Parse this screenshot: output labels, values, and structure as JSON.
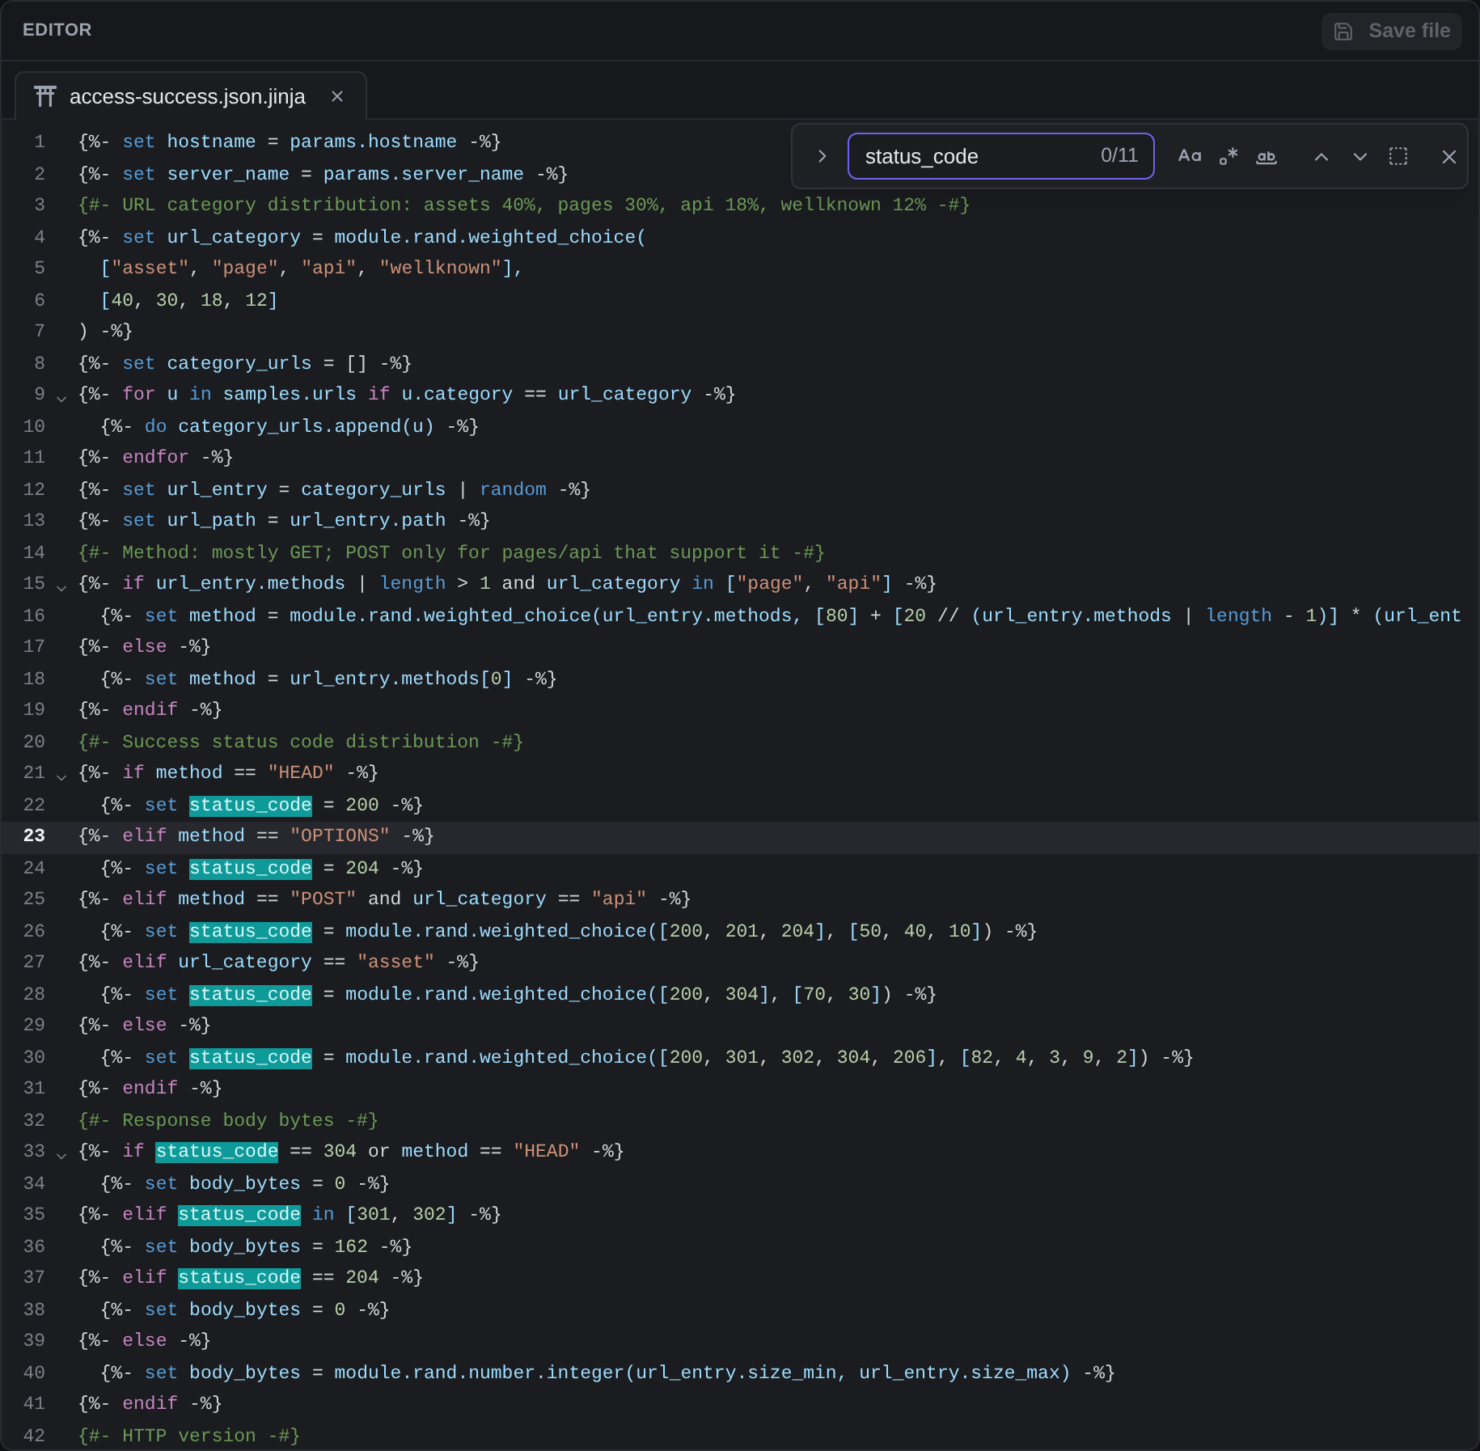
{
  "header": {
    "title": "EDITOR",
    "save_button": {
      "label": "Save file",
      "disabled": true
    }
  },
  "tabs": [
    {
      "label": "access-success.json.jinja",
      "selected": true
    }
  ],
  "find": {
    "value": "status_code",
    "count": "0/11"
  },
  "lines": [
    {
      "number": "1",
      "fold": false,
      "current": false,
      "tokens": [
        {
          "kind": "punct",
          "text": "{%- "
        },
        {
          "kind": "keyword",
          "text": "set"
        },
        {
          "kind": "name",
          "text": " hostname "
        },
        {
          "kind": "punct",
          "text": "= "
        },
        {
          "kind": "name",
          "text": "params.hostname "
        },
        {
          "kind": "punct",
          "text": "-%}"
        }
      ]
    },
    {
      "number": "2",
      "fold": false,
      "current": false,
      "tokens": [
        {
          "kind": "punct",
          "text": "{%- "
        },
        {
          "kind": "keyword",
          "text": "set"
        },
        {
          "kind": "name",
          "text": " server_name "
        },
        {
          "kind": "punct",
          "text": "= "
        },
        {
          "kind": "name",
          "text": "params.server_name "
        },
        {
          "kind": "punct",
          "text": "-%}"
        }
      ]
    },
    {
      "number": "3",
      "fold": false,
      "current": false,
      "tokens": [
        {
          "kind": "comment",
          "text": "{#- URL category distribution: assets 40%, pages 30%, api 18%, wellknown 12% -#}"
        }
      ]
    },
    {
      "number": "4",
      "fold": false,
      "current": false,
      "tokens": [
        {
          "kind": "punct",
          "text": "{%- "
        },
        {
          "kind": "keyword",
          "text": "set"
        },
        {
          "kind": "name",
          "text": " url_category "
        },
        {
          "kind": "punct",
          "text": "= "
        },
        {
          "kind": "name",
          "text": "module.rand.weighted_choice("
        }
      ]
    },
    {
      "number": "5",
      "fold": false,
      "current": false,
      "tokens": [
        {
          "kind": "name",
          "text": "  ["
        },
        {
          "kind": "string",
          "text": "\"asset\""
        },
        {
          "kind": "punct",
          "text": ", "
        },
        {
          "kind": "string",
          "text": "\"page\""
        },
        {
          "kind": "punct",
          "text": ", "
        },
        {
          "kind": "string",
          "text": "\"api\""
        },
        {
          "kind": "punct",
          "text": ", "
        },
        {
          "kind": "string",
          "text": "\"wellknown\""
        },
        {
          "kind": "name",
          "text": "],"
        }
      ]
    },
    {
      "number": "6",
      "fold": false,
      "current": false,
      "tokens": [
        {
          "kind": "name",
          "text": "  ["
        },
        {
          "kind": "number",
          "text": "40"
        },
        {
          "kind": "punct",
          "text": ", "
        },
        {
          "kind": "number",
          "text": "30"
        },
        {
          "kind": "punct",
          "text": ", "
        },
        {
          "kind": "number",
          "text": "18"
        },
        {
          "kind": "punct",
          "text": ", "
        },
        {
          "kind": "number",
          "text": "12"
        },
        {
          "kind": "name",
          "text": "]"
        }
      ]
    },
    {
      "number": "7",
      "fold": false,
      "current": false,
      "tokens": [
        {
          "kind": "punct",
          "text": ") -%}"
        }
      ]
    },
    {
      "number": "8",
      "fold": false,
      "current": false,
      "tokens": [
        {
          "kind": "punct",
          "text": "{%- "
        },
        {
          "kind": "keyword",
          "text": "set"
        },
        {
          "kind": "name",
          "text": " category_urls "
        },
        {
          "kind": "punct",
          "text": "= [] -%}"
        }
      ]
    },
    {
      "number": "9",
      "fold": true,
      "current": false,
      "tokens": [
        {
          "kind": "punct",
          "text": "{%- "
        },
        {
          "kind": "control",
          "text": "for"
        },
        {
          "kind": "name",
          "text": " u "
        },
        {
          "kind": "keyword",
          "text": "in"
        },
        {
          "kind": "name",
          "text": " samples.urls "
        },
        {
          "kind": "control",
          "text": "if"
        },
        {
          "kind": "name",
          "text": " u.category "
        },
        {
          "kind": "punct",
          "text": "== "
        },
        {
          "kind": "name",
          "text": "url_category "
        },
        {
          "kind": "punct",
          "text": "-%}"
        }
      ]
    },
    {
      "number": "10",
      "fold": false,
      "current": false,
      "tokens": [
        {
          "kind": "punct",
          "text": "  {%- "
        },
        {
          "kind": "keyword",
          "text": "do"
        },
        {
          "kind": "name",
          "text": " category_urls.append(u) "
        },
        {
          "kind": "punct",
          "text": "-%}"
        }
      ]
    },
    {
      "number": "11",
      "fold": false,
      "current": false,
      "tokens": [
        {
          "kind": "punct",
          "text": "{%- "
        },
        {
          "kind": "control",
          "text": "endfor"
        },
        {
          "kind": "punct",
          "text": " -%}"
        }
      ]
    },
    {
      "number": "12",
      "fold": false,
      "current": false,
      "tokens": [
        {
          "kind": "punct",
          "text": "{%- "
        },
        {
          "kind": "keyword",
          "text": "set"
        },
        {
          "kind": "name",
          "text": " url_entry "
        },
        {
          "kind": "punct",
          "text": "= "
        },
        {
          "kind": "name",
          "text": "category_urls "
        },
        {
          "kind": "punct",
          "text": "| "
        },
        {
          "kind": "keyword",
          "text": "random"
        },
        {
          "kind": "punct",
          "text": " -%}"
        }
      ]
    },
    {
      "number": "13",
      "fold": false,
      "current": false,
      "tokens": [
        {
          "kind": "punct",
          "text": "{%- "
        },
        {
          "kind": "keyword",
          "text": "set"
        },
        {
          "kind": "name",
          "text": " url_path "
        },
        {
          "kind": "punct",
          "text": "= "
        },
        {
          "kind": "name",
          "text": "url_entry.path "
        },
        {
          "kind": "punct",
          "text": "-%}"
        }
      ]
    },
    {
      "number": "14",
      "fold": false,
      "current": false,
      "tokens": [
        {
          "kind": "comment",
          "text": "{#- Method: mostly GET; POST only for pages/api that support it -#}"
        }
      ]
    },
    {
      "number": "15",
      "fold": true,
      "current": false,
      "tokens": [
        {
          "kind": "punct",
          "text": "{%- "
        },
        {
          "kind": "control",
          "text": "if"
        },
        {
          "kind": "name",
          "text": " url_entry.methods "
        },
        {
          "kind": "punct",
          "text": "| "
        },
        {
          "kind": "keyword",
          "text": "length"
        },
        {
          "kind": "punct",
          "text": " > "
        },
        {
          "kind": "number",
          "text": "1"
        },
        {
          "kind": "punct",
          "text": " and "
        },
        {
          "kind": "name",
          "text": "url_category "
        },
        {
          "kind": "keyword",
          "text": "in"
        },
        {
          "kind": "name",
          "text": " ["
        },
        {
          "kind": "string",
          "text": "\"page\""
        },
        {
          "kind": "punct",
          "text": ", "
        },
        {
          "kind": "string",
          "text": "\"api\""
        },
        {
          "kind": "name",
          "text": "]"
        },
        {
          "kind": "punct",
          "text": " -%}"
        }
      ]
    },
    {
      "number": "16",
      "fold": false,
      "current": false,
      "tokens": [
        {
          "kind": "punct",
          "text": "  {%- "
        },
        {
          "kind": "keyword",
          "text": "set"
        },
        {
          "kind": "name",
          "text": " method "
        },
        {
          "kind": "punct",
          "text": "= "
        },
        {
          "kind": "name",
          "text": "module.rand.weighted_choice(url_entry.methods, ["
        },
        {
          "kind": "number",
          "text": "80"
        },
        {
          "kind": "name",
          "text": "]"
        },
        {
          "kind": "punct",
          "text": " + "
        },
        {
          "kind": "name",
          "text": "["
        },
        {
          "kind": "number",
          "text": "20"
        },
        {
          "kind": "punct",
          "text": " // "
        },
        {
          "kind": "name",
          "text": "(url_entry.methods "
        },
        {
          "kind": "punct",
          "text": "| "
        },
        {
          "kind": "keyword",
          "text": "length"
        },
        {
          "kind": "punct",
          "text": " - "
        },
        {
          "kind": "number",
          "text": "1"
        },
        {
          "kind": "name",
          "text": ")]"
        },
        {
          "kind": "punct",
          "text": " * "
        },
        {
          "kind": "name",
          "text": "(url_ent"
        }
      ]
    },
    {
      "number": "17",
      "fold": false,
      "current": false,
      "tokens": [
        {
          "kind": "punct",
          "text": "{%- "
        },
        {
          "kind": "control",
          "text": "else"
        },
        {
          "kind": "punct",
          "text": " -%}"
        }
      ]
    },
    {
      "number": "18",
      "fold": false,
      "current": false,
      "tokens": [
        {
          "kind": "punct",
          "text": "  {%- "
        },
        {
          "kind": "keyword",
          "text": "set"
        },
        {
          "kind": "name",
          "text": " method "
        },
        {
          "kind": "punct",
          "text": "= "
        },
        {
          "kind": "name",
          "text": "url_entry.methods["
        },
        {
          "kind": "number",
          "text": "0"
        },
        {
          "kind": "name",
          "text": "]"
        },
        {
          "kind": "punct",
          "text": " -%}"
        }
      ]
    },
    {
      "number": "19",
      "fold": false,
      "current": false,
      "tokens": [
        {
          "kind": "punct",
          "text": "{%- "
        },
        {
          "kind": "control",
          "text": "endif"
        },
        {
          "kind": "punct",
          "text": " -%}"
        }
      ]
    },
    {
      "number": "20",
      "fold": false,
      "current": false,
      "tokens": [
        {
          "kind": "comment",
          "text": "{#- Success status code distribution -#}"
        }
      ]
    },
    {
      "number": "21",
      "fold": true,
      "current": false,
      "tokens": [
        {
          "kind": "punct",
          "text": "{%- "
        },
        {
          "kind": "control",
          "text": "if"
        },
        {
          "kind": "name",
          "text": " method "
        },
        {
          "kind": "punct",
          "text": "== "
        },
        {
          "kind": "string",
          "text": "\"HEAD\""
        },
        {
          "kind": "punct",
          "text": " -%}"
        }
      ]
    },
    {
      "number": "22",
      "fold": false,
      "current": false,
      "tokens": [
        {
          "kind": "punct",
          "text": "  {%- "
        },
        {
          "kind": "keyword",
          "text": "set "
        },
        {
          "kind": "match",
          "text": "status_code"
        },
        {
          "kind": "punct",
          "text": " = "
        },
        {
          "kind": "number",
          "text": "200"
        },
        {
          "kind": "punct",
          "text": " -%}"
        }
      ]
    },
    {
      "number": "23",
      "fold": false,
      "current": true,
      "tokens": [
        {
          "kind": "punct",
          "text": "{%- "
        },
        {
          "kind": "control",
          "text": "elif"
        },
        {
          "kind": "name",
          "text": " method "
        },
        {
          "kind": "punct",
          "text": "== "
        },
        {
          "kind": "string",
          "text": "\"OPTIONS\""
        },
        {
          "kind": "punct",
          "text": " -%}"
        }
      ]
    },
    {
      "number": "24",
      "fold": false,
      "current": false,
      "tokens": [
        {
          "kind": "punct",
          "text": "  {%- "
        },
        {
          "kind": "keyword",
          "text": "set "
        },
        {
          "kind": "match",
          "text": "status_code"
        },
        {
          "kind": "punct",
          "text": " = "
        },
        {
          "kind": "number",
          "text": "204"
        },
        {
          "kind": "punct",
          "text": " -%}"
        }
      ]
    },
    {
      "number": "25",
      "fold": false,
      "current": false,
      "tokens": [
        {
          "kind": "punct",
          "text": "{%- "
        },
        {
          "kind": "control",
          "text": "elif"
        },
        {
          "kind": "name",
          "text": " method "
        },
        {
          "kind": "punct",
          "text": "== "
        },
        {
          "kind": "string",
          "text": "\"POST\""
        },
        {
          "kind": "punct",
          "text": " and "
        },
        {
          "kind": "name",
          "text": "url_category "
        },
        {
          "kind": "punct",
          "text": "== "
        },
        {
          "kind": "string",
          "text": "\"api\""
        },
        {
          "kind": "punct",
          "text": " -%}"
        }
      ]
    },
    {
      "number": "26",
      "fold": false,
      "current": false,
      "tokens": [
        {
          "kind": "punct",
          "text": "  {%- "
        },
        {
          "kind": "keyword",
          "text": "set "
        },
        {
          "kind": "match",
          "text": "status_code"
        },
        {
          "kind": "punct",
          "text": " = "
        },
        {
          "kind": "name",
          "text": "module.rand.weighted_choice(["
        },
        {
          "kind": "number",
          "text": "200"
        },
        {
          "kind": "punct",
          "text": ", "
        },
        {
          "kind": "number",
          "text": "201"
        },
        {
          "kind": "punct",
          "text": ", "
        },
        {
          "kind": "number",
          "text": "204"
        },
        {
          "kind": "name",
          "text": "]"
        },
        {
          "kind": "punct",
          "text": ", "
        },
        {
          "kind": "name",
          "text": "["
        },
        {
          "kind": "number",
          "text": "50"
        },
        {
          "kind": "punct",
          "text": ", "
        },
        {
          "kind": "number",
          "text": "40"
        },
        {
          "kind": "punct",
          "text": ", "
        },
        {
          "kind": "number",
          "text": "10"
        },
        {
          "kind": "name",
          "text": "]"
        },
        {
          "kind": "punct",
          "text": ") -%}"
        }
      ]
    },
    {
      "number": "27",
      "fold": false,
      "current": false,
      "tokens": [
        {
          "kind": "punct",
          "text": "{%- "
        },
        {
          "kind": "control",
          "text": "elif"
        },
        {
          "kind": "name",
          "text": " url_category "
        },
        {
          "kind": "punct",
          "text": "== "
        },
        {
          "kind": "string",
          "text": "\"asset\""
        },
        {
          "kind": "punct",
          "text": " -%}"
        }
      ]
    },
    {
      "number": "28",
      "fold": false,
      "current": false,
      "tokens": [
        {
          "kind": "punct",
          "text": "  {%- "
        },
        {
          "kind": "keyword",
          "text": "set "
        },
        {
          "kind": "match",
          "text": "status_code"
        },
        {
          "kind": "punct",
          "text": " = "
        },
        {
          "kind": "name",
          "text": "module.rand.weighted_choice(["
        },
        {
          "kind": "number",
          "text": "200"
        },
        {
          "kind": "punct",
          "text": ", "
        },
        {
          "kind": "number",
          "text": "304"
        },
        {
          "kind": "name",
          "text": "]"
        },
        {
          "kind": "punct",
          "text": ", "
        },
        {
          "kind": "name",
          "text": "["
        },
        {
          "kind": "number",
          "text": "70"
        },
        {
          "kind": "punct",
          "text": ", "
        },
        {
          "kind": "number",
          "text": "30"
        },
        {
          "kind": "name",
          "text": "]"
        },
        {
          "kind": "punct",
          "text": ") -%}"
        }
      ]
    },
    {
      "number": "29",
      "fold": false,
      "current": false,
      "tokens": [
        {
          "kind": "punct",
          "text": "{%- "
        },
        {
          "kind": "control",
          "text": "else"
        },
        {
          "kind": "punct",
          "text": " -%}"
        }
      ]
    },
    {
      "number": "30",
      "fold": false,
      "current": false,
      "tokens": [
        {
          "kind": "punct",
          "text": "  {%- "
        },
        {
          "kind": "keyword",
          "text": "set "
        },
        {
          "kind": "match",
          "text": "status_code"
        },
        {
          "kind": "punct",
          "text": " = "
        },
        {
          "kind": "name",
          "text": "module.rand.weighted_choice(["
        },
        {
          "kind": "number",
          "text": "200"
        },
        {
          "kind": "punct",
          "text": ", "
        },
        {
          "kind": "number",
          "text": "301"
        },
        {
          "kind": "punct",
          "text": ", "
        },
        {
          "kind": "number",
          "text": "302"
        },
        {
          "kind": "punct",
          "text": ", "
        },
        {
          "kind": "number",
          "text": "304"
        },
        {
          "kind": "punct",
          "text": ", "
        },
        {
          "kind": "number",
          "text": "206"
        },
        {
          "kind": "name",
          "text": "]"
        },
        {
          "kind": "punct",
          "text": ", "
        },
        {
          "kind": "name",
          "text": "["
        },
        {
          "kind": "number",
          "text": "82"
        },
        {
          "kind": "punct",
          "text": ", "
        },
        {
          "kind": "number",
          "text": "4"
        },
        {
          "kind": "punct",
          "text": ", "
        },
        {
          "kind": "number",
          "text": "3"
        },
        {
          "kind": "punct",
          "text": ", "
        },
        {
          "kind": "number",
          "text": "9"
        },
        {
          "kind": "punct",
          "text": ", "
        },
        {
          "kind": "number",
          "text": "2"
        },
        {
          "kind": "name",
          "text": "]"
        },
        {
          "kind": "punct",
          "text": ") -%}"
        }
      ]
    },
    {
      "number": "31",
      "fold": false,
      "current": false,
      "tokens": [
        {
          "kind": "punct",
          "text": "{%- "
        },
        {
          "kind": "control",
          "text": "endif"
        },
        {
          "kind": "punct",
          "text": " -%}"
        }
      ]
    },
    {
      "number": "32",
      "fold": false,
      "current": false,
      "tokens": [
        {
          "kind": "comment",
          "text": "{#- Response body bytes -#}"
        }
      ]
    },
    {
      "number": "33",
      "fold": true,
      "current": false,
      "tokens": [
        {
          "kind": "punct",
          "text": "{%- "
        },
        {
          "kind": "control",
          "text": "if "
        },
        {
          "kind": "match",
          "text": "status_code"
        },
        {
          "kind": "punct",
          "text": " == "
        },
        {
          "kind": "number",
          "text": "304"
        },
        {
          "kind": "punct",
          "text": " or "
        },
        {
          "kind": "name",
          "text": "method "
        },
        {
          "kind": "punct",
          "text": "== "
        },
        {
          "kind": "string",
          "text": "\"HEAD\""
        },
        {
          "kind": "punct",
          "text": " -%}"
        }
      ]
    },
    {
      "number": "34",
      "fold": false,
      "current": false,
      "tokens": [
        {
          "kind": "punct",
          "text": "  {%- "
        },
        {
          "kind": "keyword",
          "text": "set"
        },
        {
          "kind": "name",
          "text": " body_bytes "
        },
        {
          "kind": "punct",
          "text": "= "
        },
        {
          "kind": "number",
          "text": "0"
        },
        {
          "kind": "punct",
          "text": " -%}"
        }
      ]
    },
    {
      "number": "35",
      "fold": false,
      "current": false,
      "tokens": [
        {
          "kind": "punct",
          "text": "{%- "
        },
        {
          "kind": "control",
          "text": "elif "
        },
        {
          "kind": "match",
          "text": "status_code"
        },
        {
          "kind": "keyword",
          "text": " in"
        },
        {
          "kind": "name",
          "text": " ["
        },
        {
          "kind": "number",
          "text": "301"
        },
        {
          "kind": "punct",
          "text": ", "
        },
        {
          "kind": "number",
          "text": "302"
        },
        {
          "kind": "name",
          "text": "]"
        },
        {
          "kind": "punct",
          "text": " -%}"
        }
      ]
    },
    {
      "number": "36",
      "fold": false,
      "current": false,
      "tokens": [
        {
          "kind": "punct",
          "text": "  {%- "
        },
        {
          "kind": "keyword",
          "text": "set"
        },
        {
          "kind": "name",
          "text": " body_bytes "
        },
        {
          "kind": "punct",
          "text": "= "
        },
        {
          "kind": "number",
          "text": "162"
        },
        {
          "kind": "punct",
          "text": " -%}"
        }
      ]
    },
    {
      "number": "37",
      "fold": false,
      "current": false,
      "tokens": [
        {
          "kind": "punct",
          "text": "{%- "
        },
        {
          "kind": "control",
          "text": "elif "
        },
        {
          "kind": "match",
          "text": "status_code"
        },
        {
          "kind": "punct",
          "text": " == "
        },
        {
          "kind": "number",
          "text": "204"
        },
        {
          "kind": "punct",
          "text": " -%}"
        }
      ]
    },
    {
      "number": "38",
      "fold": false,
      "current": false,
      "tokens": [
        {
          "kind": "punct",
          "text": "  {%- "
        },
        {
          "kind": "keyword",
          "text": "set"
        },
        {
          "kind": "name",
          "text": " body_bytes "
        },
        {
          "kind": "punct",
          "text": "= "
        },
        {
          "kind": "number",
          "text": "0"
        },
        {
          "kind": "punct",
          "text": " -%}"
        }
      ]
    },
    {
      "number": "39",
      "fold": false,
      "current": false,
      "tokens": [
        {
          "kind": "punct",
          "text": "{%- "
        },
        {
          "kind": "control",
          "text": "else"
        },
        {
          "kind": "punct",
          "text": " -%}"
        }
      ]
    },
    {
      "number": "40",
      "fold": false,
      "current": false,
      "tokens": [
        {
          "kind": "punct",
          "text": "  {%- "
        },
        {
          "kind": "keyword",
          "text": "set"
        },
        {
          "kind": "name",
          "text": " body_bytes "
        },
        {
          "kind": "punct",
          "text": "= "
        },
        {
          "kind": "name",
          "text": "module.rand.number.integer(url_entry.size_min, url_entry.size_max) "
        },
        {
          "kind": "punct",
          "text": "-%}"
        }
      ]
    },
    {
      "number": "41",
      "fold": false,
      "current": false,
      "tokens": [
        {
          "kind": "punct",
          "text": "{%- "
        },
        {
          "kind": "control",
          "text": "endif"
        },
        {
          "kind": "punct",
          "text": " -%}"
        }
      ]
    },
    {
      "number": "42",
      "fold": false,
      "current": false,
      "tokens": [
        {
          "kind": "comment",
          "text": "{#- HTTP version -#}"
        }
      ]
    }
  ]
}
